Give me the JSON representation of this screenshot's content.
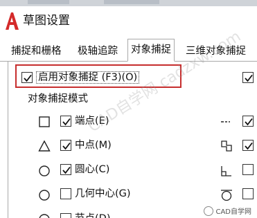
{
  "window": {
    "title": "草图设置",
    "logo_letter": "A",
    "accent_color": "#c62d2d"
  },
  "tabs": [
    {
      "label": "捕捉和栅格",
      "active": false
    },
    {
      "label": "极轴追踪",
      "active": false
    },
    {
      "label": "对象捕捉",
      "active": true
    },
    {
      "label": "三维对象捕捉",
      "active": false
    }
  ],
  "snap_toggle": {
    "label": "启用对象捕捉 (F3)(O)",
    "checked": true
  },
  "right_checkbox_top": {
    "checked": true
  },
  "modes_group": {
    "label": "对象捕捉模式",
    "items": [
      {
        "symbol": "square-icon",
        "label": "端点(E)",
        "checked": true
      },
      {
        "symbol": "triangle-icon",
        "label": "中点(M)",
        "checked": true
      },
      {
        "symbol": "circle-icon",
        "label": "圆心(C)",
        "checked": true
      },
      {
        "symbol": "circle-icon",
        "label": "几何中心(G)",
        "checked": false
      },
      {
        "symbol": "circle-icon",
        "label": "节点(D)",
        "checked": false
      }
    ]
  },
  "right_column": [
    {
      "symbol": "extension-icon",
      "checked": true
    },
    {
      "symbol": "insertion-icon",
      "checked": true
    },
    {
      "symbol": "perpendicular-icon",
      "checked": false
    },
    {
      "symbol": "tangent-icon",
      "checked": false
    }
  ],
  "watermark": {
    "text": "CAD自学网 cadzxw.com",
    "brand": "CAD自学网"
  }
}
